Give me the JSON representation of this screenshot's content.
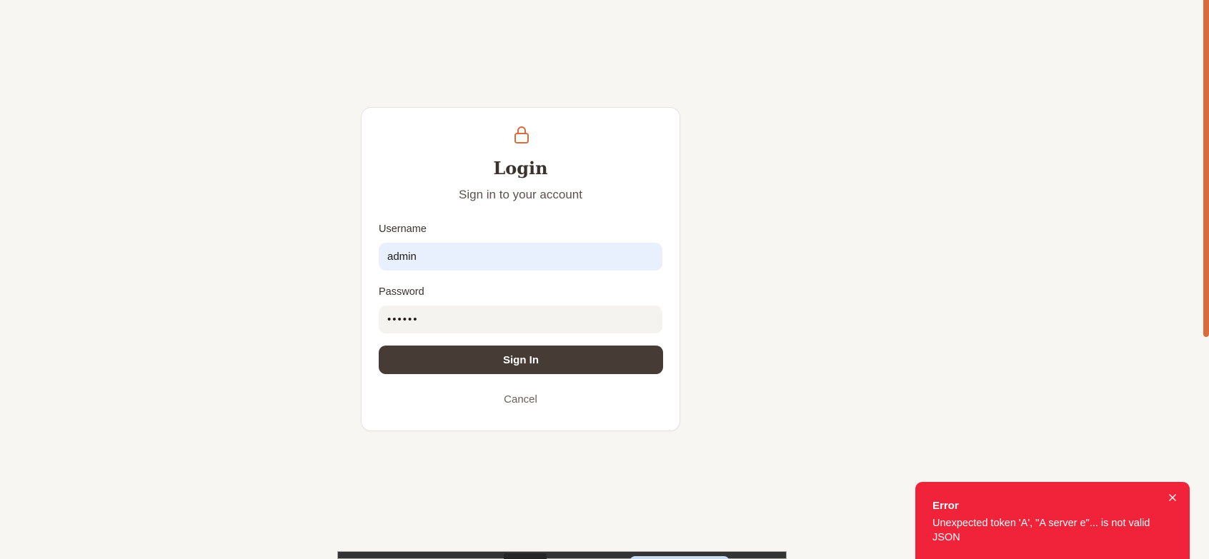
{
  "login": {
    "title": "Login",
    "subtitle": "Sign in to your account",
    "username_label": "Username",
    "username_value": "admin",
    "password_label": "Password",
    "password_value": "••••••",
    "signin_label": "Sign In",
    "cancel_label": "Cancel",
    "icon": "lock-icon"
  },
  "toast": {
    "title": "Error",
    "message": "Unexpected token 'A', \"A server e\"... is not valid JSON",
    "icon": "close-icon"
  },
  "colors": {
    "accent": "#d66d3e",
    "primary_button": "#473b35",
    "error": "#f1233a",
    "background": "#f7f6f2"
  }
}
